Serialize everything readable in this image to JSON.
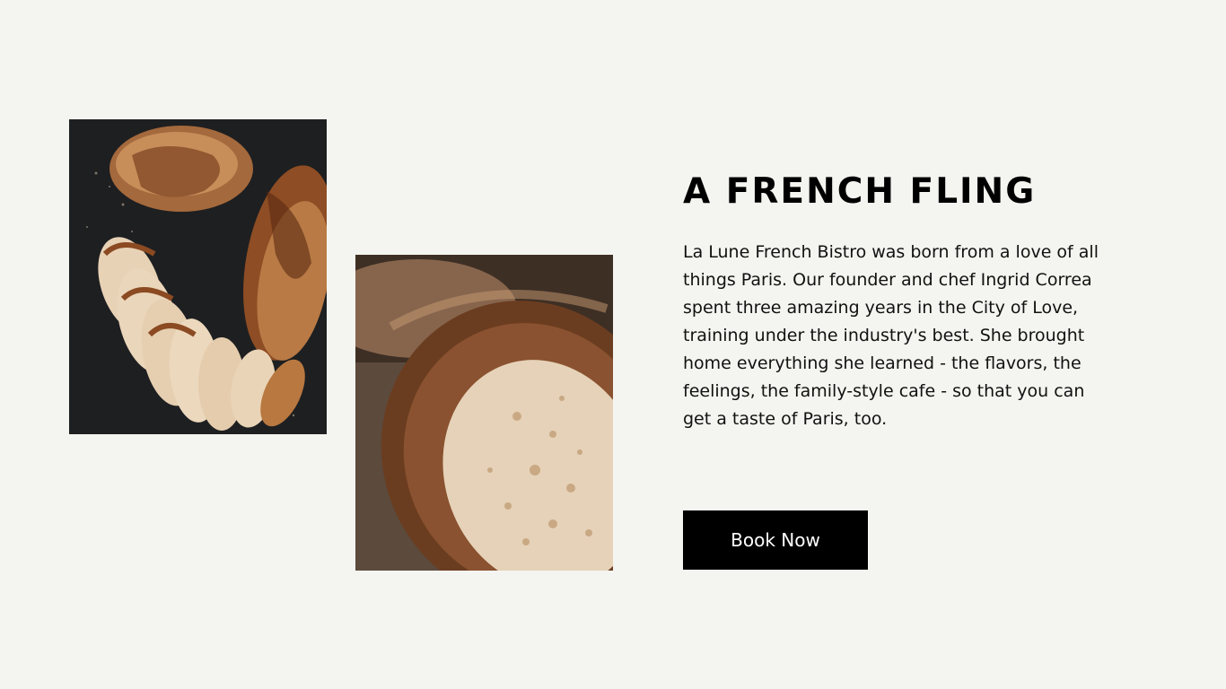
{
  "about": {
    "heading": "A FRENCH FLING",
    "paragraph": "La Lune French Bistro was born from a love of all things Paris. Our founder and chef Ingrid Correa spent three amazing years in the City of Love, training under the industry's best. She brought home everything she learned - the flavors, the feelings, the family-style cafe - so that you can get a taste of Paris, too.",
    "cta_label": "Book Now"
  },
  "images": [
    {
      "name": "grilled-chicken-photo"
    },
    {
      "name": "sourdough-bread-photo"
    }
  ],
  "colors": {
    "background": "#f4f4f0",
    "text": "#000000",
    "button_bg": "#000000",
    "button_text": "#ffffff"
  }
}
